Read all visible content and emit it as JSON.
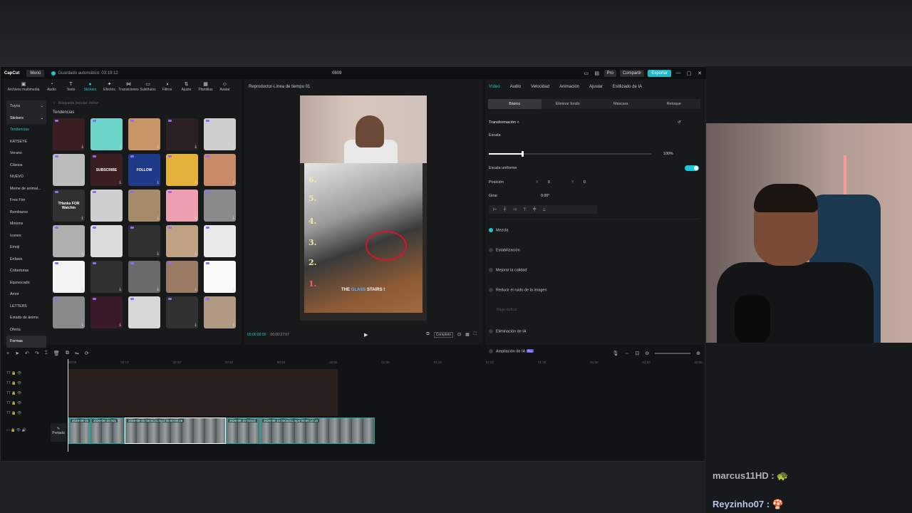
{
  "app": {
    "logo": "CapCut",
    "menu": "Menú",
    "autosave": "Guardado automático: 03:19:12",
    "project": "0809",
    "pro": "Pro",
    "share": "Compartir",
    "export": "Exportar"
  },
  "tools": [
    {
      "label": "Archivos multimedia",
      "icon": "media-icon"
    },
    {
      "label": "Audio",
      "icon": "audio-icon"
    },
    {
      "label": "Texto",
      "icon": "text-icon"
    },
    {
      "label": "Stickers",
      "icon": "stickers-icon"
    },
    {
      "label": "Efectos",
      "icon": "effects-icon"
    },
    {
      "label": "Transiciones",
      "icon": "transitions-icon"
    },
    {
      "label": "Subtítulos",
      "icon": "subtitles-icon"
    },
    {
      "label": "Filtros",
      "icon": "filters-icon"
    },
    {
      "label": "Ajuste",
      "icon": "adjust-icon"
    },
    {
      "label": "Plantillas",
      "icon": "templates-icon"
    },
    {
      "label": "Avatar",
      "icon": "avatar-icon"
    }
  ],
  "categories": [
    "Tuyos",
    "Stickers",
    "Tendencias",
    "KATSEYE",
    "Verano",
    "Clásica",
    "NUEVO",
    "Meme de animal...",
    "Free Fire",
    "Bombazos",
    "Minions",
    "Iconos",
    "Emoji",
    "Énfasis",
    "Coberturas",
    "Equivocado",
    "Amor",
    "LETTERS",
    "Estado de ánimo",
    "Oferta",
    "Formas"
  ],
  "search_placeholder": "Búsqueda popular: follow",
  "section_title": "Tendencias",
  "stickers": [
    "",
    "",
    "",
    "",
    "",
    "",
    "SUBSCRIBE",
    "FOLLOW",
    "",
    "",
    "THanks FOR Watchin",
    "",
    "",
    "",
    "",
    "",
    "",
    "",
    "",
    "",
    "",
    "",
    "",
    "",
    "",
    "",
    "",
    "",
    "",
    ""
  ],
  "player": {
    "title": "Reproductor-Línea de tiempo 01",
    "current": "00:00:00:00",
    "total": "00:00:27:07",
    "ratio": "Completo",
    "ranks": [
      "6.",
      "5.",
      "4.",
      "3.",
      "2.",
      "1."
    ],
    "caption_a": "THE ",
    "caption_b": "GLASS",
    "caption_c": " STAIRS !"
  },
  "inspector": {
    "tabs": [
      "Vídeo",
      "Audio",
      "Velocidad",
      "Animación",
      "Ajustar",
      "Estilizado de IA"
    ],
    "subtabs": [
      "Básico",
      "Eliminar fondo",
      "Máscara",
      "Retoque"
    ],
    "transform": "Transformación",
    "scale": "Escala",
    "scale_value": "100%",
    "uniform": "Escala uniforme",
    "position": "Posición",
    "x_label": "X",
    "x_value": "0",
    "y_label": "Y",
    "y_value": "0",
    "rotate": "Girar",
    "rotate_value": "0.00°",
    "blend": "Mezcla",
    "stabilize": "Estabilización",
    "quality": "Mejorar la calidad",
    "noise": "Reducir el ruido de la imagen",
    "flow": "Flujo óptico",
    "ai_remove": "Eliminación de IA",
    "ai_expand": "Ampliación de IA",
    "ai_expand_badge": "Pro"
  },
  "timeline": {
    "ruler": [
      "00:00",
      "00:10",
      "00:20",
      "00:30",
      "00:40",
      "00:50",
      "01:00",
      "01:10",
      "01:20",
      "01:30",
      "01:40",
      "01:50",
      "02:00"
    ],
    "cover": "Portada",
    "clips": [
      {
        "label": "2026-08-15"
      },
      {
        "label": "2026-08-15 015"
      },
      {
        "label": "2026-08-15 03c5c31.mp4  00:00:08:26"
      },
      {
        "label": "2026-08-15 015c0"
      },
      {
        "label": "2026-08-16 03c5c51.mp4  00:00:10:10"
      }
    ]
  },
  "chat": [
    {
      "user": "marcus11HD :"
    },
    {
      "user": "Reyzinho07 :"
    }
  ]
}
